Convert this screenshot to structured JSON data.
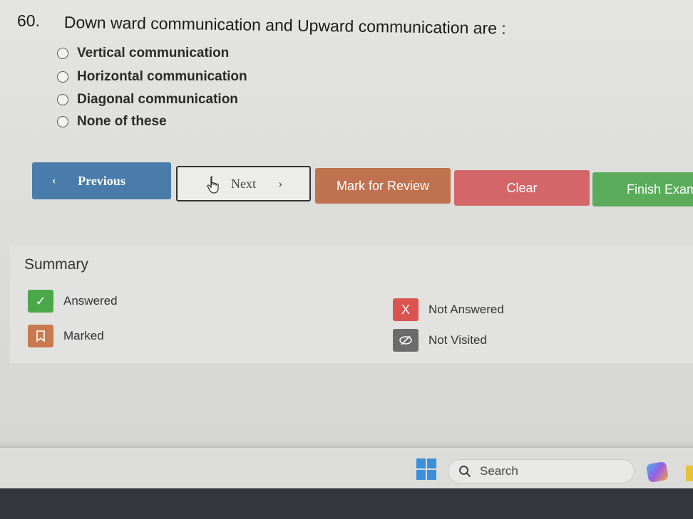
{
  "question": {
    "number": "60.",
    "text": "Down ward communication and Upward communication are :"
  },
  "options": [
    {
      "label": "Vertical communication"
    },
    {
      "label": "Horizontal communication"
    },
    {
      "label": "Diagonal communication"
    },
    {
      "label": "None of these"
    }
  ],
  "buttons": {
    "previous": "Previous",
    "next": "Next",
    "review": "Mark for Review",
    "clear": "Clear",
    "finish": "Finish Exam"
  },
  "summary": {
    "title": "Summary",
    "answered": "Answered",
    "not_answered": "Not Answered",
    "marked": "Marked",
    "not_visited": "Not Visited",
    "answered_icon": "✓",
    "not_answered_icon": "X"
  },
  "taskbar": {
    "search_placeholder": "Search"
  },
  "colors": {
    "previous": "#4a7cab",
    "review": "#c0714f",
    "clear": "#d4666a",
    "finish": "#5aac5a",
    "answered": "#4aa84a",
    "not_answered": "#d9534f",
    "marked": "#c87a4e",
    "not_visited": "#6b6b6b"
  },
  "icons": [
    "chevron-left-icon",
    "hand-pointer-icon",
    "chevron-right-icon",
    "check-icon",
    "bookmark-icon",
    "eye-slash-icon",
    "windows-start-icon",
    "search-icon",
    "copilot-icon"
  ]
}
